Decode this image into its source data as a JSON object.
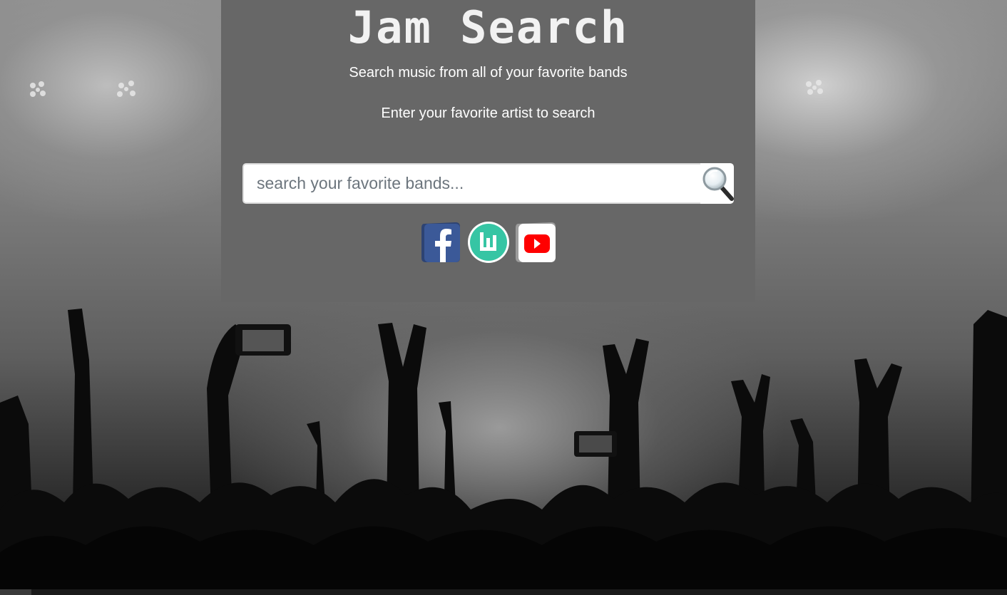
{
  "header": {
    "title": "Jam Search",
    "subtitle": "Search music from all of your favorite bands",
    "prompt": "Enter your favorite artist to search"
  },
  "search": {
    "placeholder": "search your favorite bands...",
    "value": "",
    "button_icon": "magnifying-glass-icon"
  },
  "socials": [
    {
      "name": "Facebook",
      "icon": "facebook-icon",
      "color": "#3b5998"
    },
    {
      "name": "Bandsintown",
      "icon": "bandsintown-icon",
      "color": "#36c5a4"
    },
    {
      "name": "YouTube",
      "icon": "youtube-icon",
      "color": "#ff0000"
    }
  ],
  "colors": {
    "panel": "#676767",
    "text": "#ffffff"
  }
}
